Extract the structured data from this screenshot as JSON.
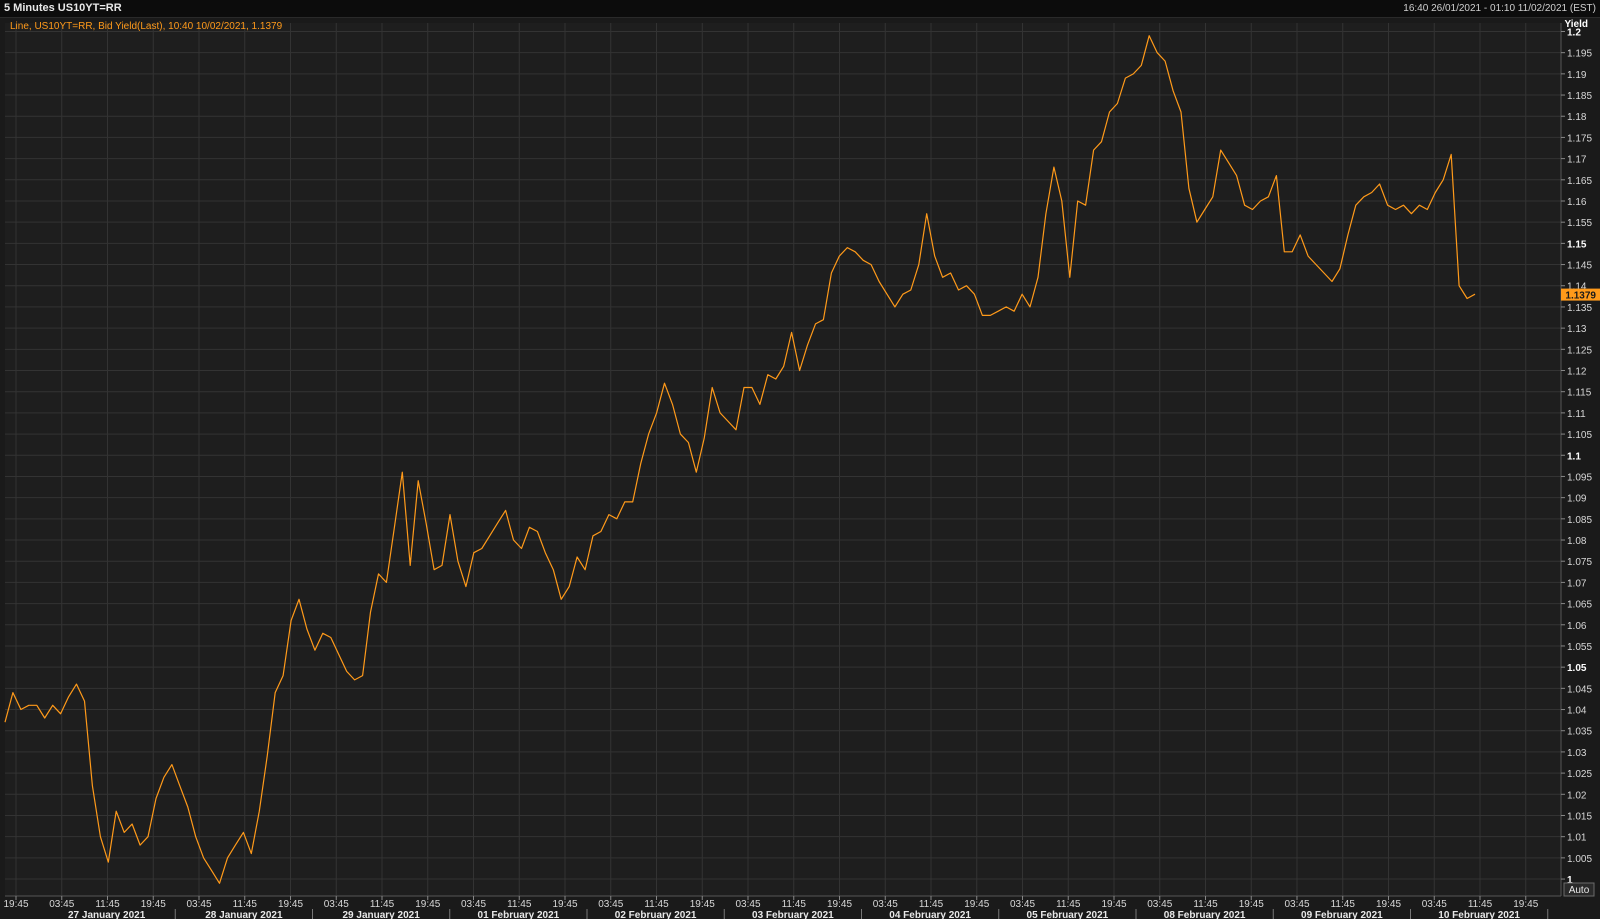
{
  "window": {
    "title": "5 Minutes US10YT=RR",
    "range": "16:40 26/01/2021 - 01:10 11/02/2021 (EST)"
  },
  "legend": "Line, US10YT=RR, Bid Yield(Last),  10:40 10/02/2021, 1.1379",
  "axis": {
    "y_title": "Yield",
    "auto_label": "Auto",
    "last_value_label": "1.1379"
  },
  "colors": {
    "background": "#1e1e1e",
    "grid": "#333333",
    "line": "#ff9a1a",
    "tag": "#ff9a1a"
  },
  "chart_data": {
    "type": "line",
    "title": "",
    "ylabel": "Yield",
    "ylim": [
      0.996,
      1.202
    ],
    "grid": true,
    "y_ticks": [
      "1.2",
      "1.195",
      "1.19",
      "1.185",
      "1.18",
      "1.175",
      "1.17",
      "1.165",
      "1.16",
      "1.155",
      "1.15",
      "1.145",
      "1.14",
      "1.135",
      "1.13",
      "1.125",
      "1.12",
      "1.115",
      "1.11",
      "1.105",
      "1.1",
      "1.095",
      "1.09",
      "1.085",
      "1.08",
      "1.075",
      "1.07",
      "1.065",
      "1.06",
      "1.055",
      "1.05",
      "1.045",
      "1.04",
      "1.035",
      "1.03",
      "1.025",
      "1.02",
      "1.015",
      "1.01",
      "1.005",
      "1"
    ],
    "y_major": [
      "1.2",
      "1.15",
      "1.1",
      "1.05",
      "1"
    ],
    "x_tick_labels": [
      "19:45",
      "03:45",
      "11:45",
      "19:45",
      "03:45",
      "11:45",
      "19:45",
      "03:45",
      "11:45",
      "19:45",
      "03:45",
      "11:45",
      "19:45",
      "03:45",
      "11:45",
      "19:45",
      "03:45",
      "11:45",
      "19:45",
      "03:45",
      "11:45",
      "19:45",
      "03:45",
      "11:45",
      "19:45",
      "03:45",
      "11:45",
      "19:45",
      "03:45",
      "11:45",
      "19:45",
      "03:45",
      "11:45",
      "19:45"
    ],
    "date_labels": [
      "27 January 2021",
      "28 January 2021",
      "29 January 2021",
      "01 February 2021",
      "02 February 2021",
      "03 February 2021",
      "04 February 2021",
      "05 February 2021",
      "08 February 2021",
      "09 February 2021",
      "10 February 2021"
    ],
    "series": [
      {
        "values": [
          1.037,
          1.044,
          1.04,
          1.041,
          1.041,
          1.038,
          1.041,
          1.039,
          1.043,
          1.046,
          1.042,
          1.022,
          1.01,
          1.004,
          1.016,
          1.011,
          1.013,
          1.008,
          1.01,
          1.019,
          1.024,
          1.027,
          1.022,
          1.017,
          1.01,
          1.005,
          1.002,
          0.999,
          1.005,
          1.008,
          1.011,
          1.006,
          1.016,
          1.029,
          1.044,
          1.048,
          1.061,
          1.066,
          1.059,
          1.054,
          1.058,
          1.057,
          1.053,
          1.049,
          1.047,
          1.048,
          1.063,
          1.072,
          1.07,
          1.083,
          1.096,
          1.074,
          1.094,
          1.084,
          1.073,
          1.074,
          1.086,
          1.075,
          1.069,
          1.077,
          1.078,
          1.081,
          1.084,
          1.087,
          1.08,
          1.078,
          1.083,
          1.082,
          1.077,
          1.073,
          1.066,
          1.069,
          1.076,
          1.073,
          1.081,
          1.082,
          1.086,
          1.085,
          1.089,
          1.089,
          1.098,
          1.105,
          1.11,
          1.117,
          1.112,
          1.105,
          1.103,
          1.096,
          1.104,
          1.116,
          1.11,
          1.108,
          1.106,
          1.116,
          1.116,
          1.112,
          1.119,
          1.118,
          1.121,
          1.129,
          1.12,
          1.126,
          1.131,
          1.132,
          1.143,
          1.147,
          1.149,
          1.148,
          1.146,
          1.145,
          1.141,
          1.138,
          1.135,
          1.138,
          1.139,
          1.145,
          1.157,
          1.147,
          1.142,
          1.143,
          1.139,
          1.14,
          1.138,
          1.133,
          1.133,
          1.134,
          1.135,
          1.134,
          1.138,
          1.135,
          1.142,
          1.157,
          1.168,
          1.16,
          1.142,
          1.16,
          1.159,
          1.172,
          1.174,
          1.181,
          1.183,
          1.189,
          1.19,
          1.192,
          1.199,
          1.195,
          1.193,
          1.186,
          1.181,
          1.163,
          1.155,
          1.158,
          1.161,
          1.172,
          1.169,
          1.166,
          1.159,
          1.158,
          1.16,
          1.161,
          1.166,
          1.148,
          1.148,
          1.152,
          1.147,
          1.145,
          1.143,
          1.141,
          1.144,
          1.152,
          1.159,
          1.161,
          1.162,
          1.164,
          1.159,
          1.158,
          1.159,
          1.157,
          1.159,
          1.158,
          1.162,
          1.165,
          1.171,
          1.14,
          1.137,
          1.138
        ]
      }
    ]
  }
}
